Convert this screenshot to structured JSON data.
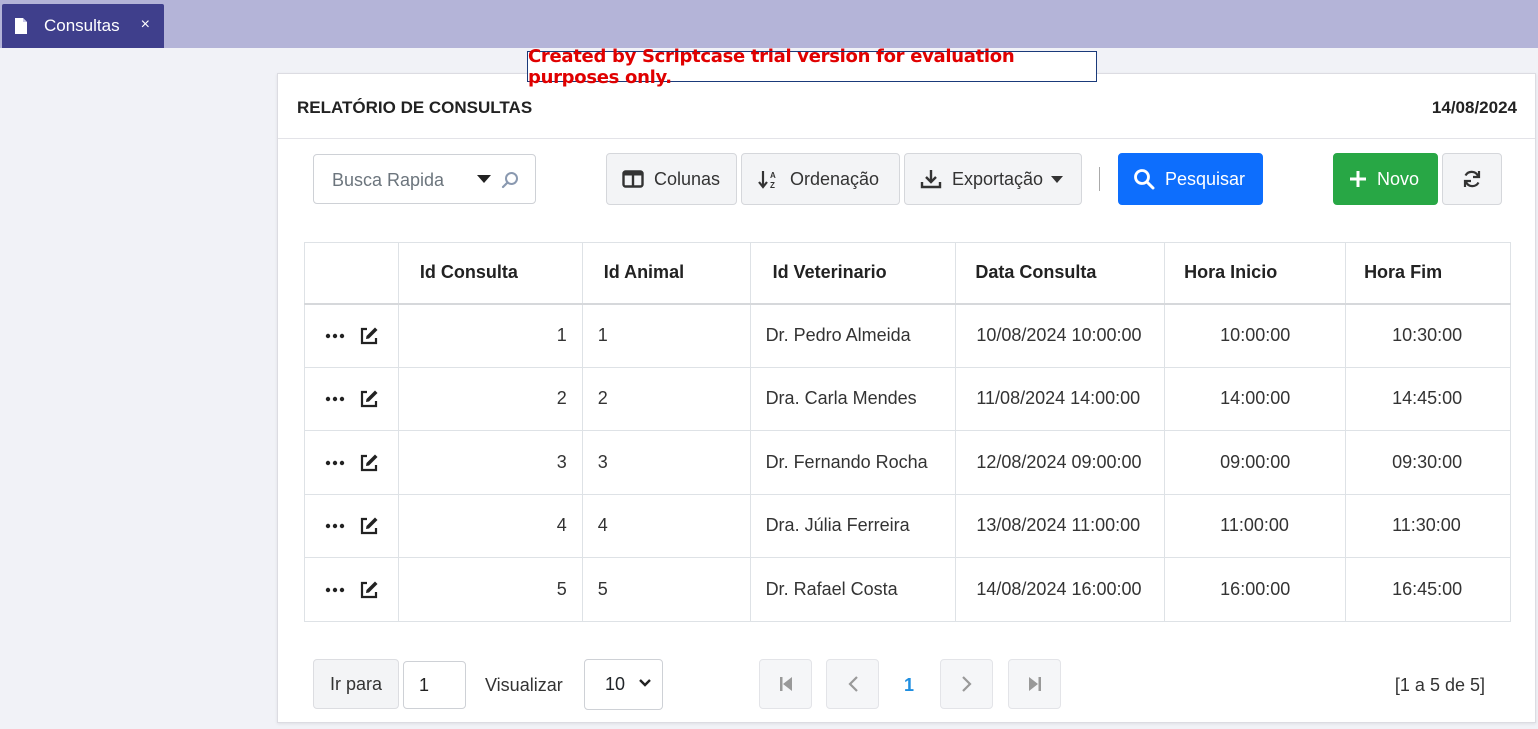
{
  "tab": {
    "label": "Consultas",
    "close": "×"
  },
  "trial_notice": "Created by Scriptcase trial version for evaluation purposes only.",
  "panel": {
    "title": "RELATÓRIO DE CONSULTAS",
    "date": "14/08/2024"
  },
  "toolbar": {
    "search_placeholder": "Busca Rapida",
    "colunas": "Colunas",
    "ordenacao": "Ordenação",
    "exportacao": "Exportação",
    "pesquisar": "Pesquisar",
    "novo": "Novo"
  },
  "table": {
    "headers": [
      "Id Consulta",
      "Id Animal",
      "Id Veterinario",
      "Data Consulta",
      "Hora Inicio",
      "Hora Fim"
    ],
    "rows": [
      {
        "id": "1",
        "animal": "1",
        "vet": "Dr. Pedro Almeida",
        "data": "10/08/2024 10:00:00",
        "inicio": "10:00:00",
        "fim": "10:30:00"
      },
      {
        "id": "2",
        "animal": "2",
        "vet": "Dra. Carla Mendes",
        "data": "11/08/2024 14:00:00",
        "inicio": "14:00:00",
        "fim": "14:45:00"
      },
      {
        "id": "3",
        "animal": "3",
        "vet": "Dr. Fernando Rocha",
        "data": "12/08/2024 09:00:00",
        "inicio": "09:00:00",
        "fim": "09:30:00"
      },
      {
        "id": "4",
        "animal": "4",
        "vet": "Dra. Júlia Ferreira",
        "data": "13/08/2024 11:00:00",
        "inicio": "11:00:00",
        "fim": "11:30:00"
      },
      {
        "id": "5",
        "animal": "5",
        "vet": "Dr. Rafael Costa",
        "data": "14/08/2024 16:00:00",
        "inicio": "16:00:00",
        "fim": "16:45:00"
      }
    ]
  },
  "pager": {
    "ir_para": "Ir para",
    "page_value": "1",
    "visualizar": "Visualizar",
    "per_page": "10",
    "current_page": "1",
    "info": "[1 a 5 de 5]"
  },
  "colors": {
    "tabbar": "#b4b4d8",
    "tab": "#3f3f8c",
    "primary": "#0d6efd",
    "success": "#28a745",
    "trial_text": "#e00000",
    "page_link": "#1f8ee0"
  }
}
